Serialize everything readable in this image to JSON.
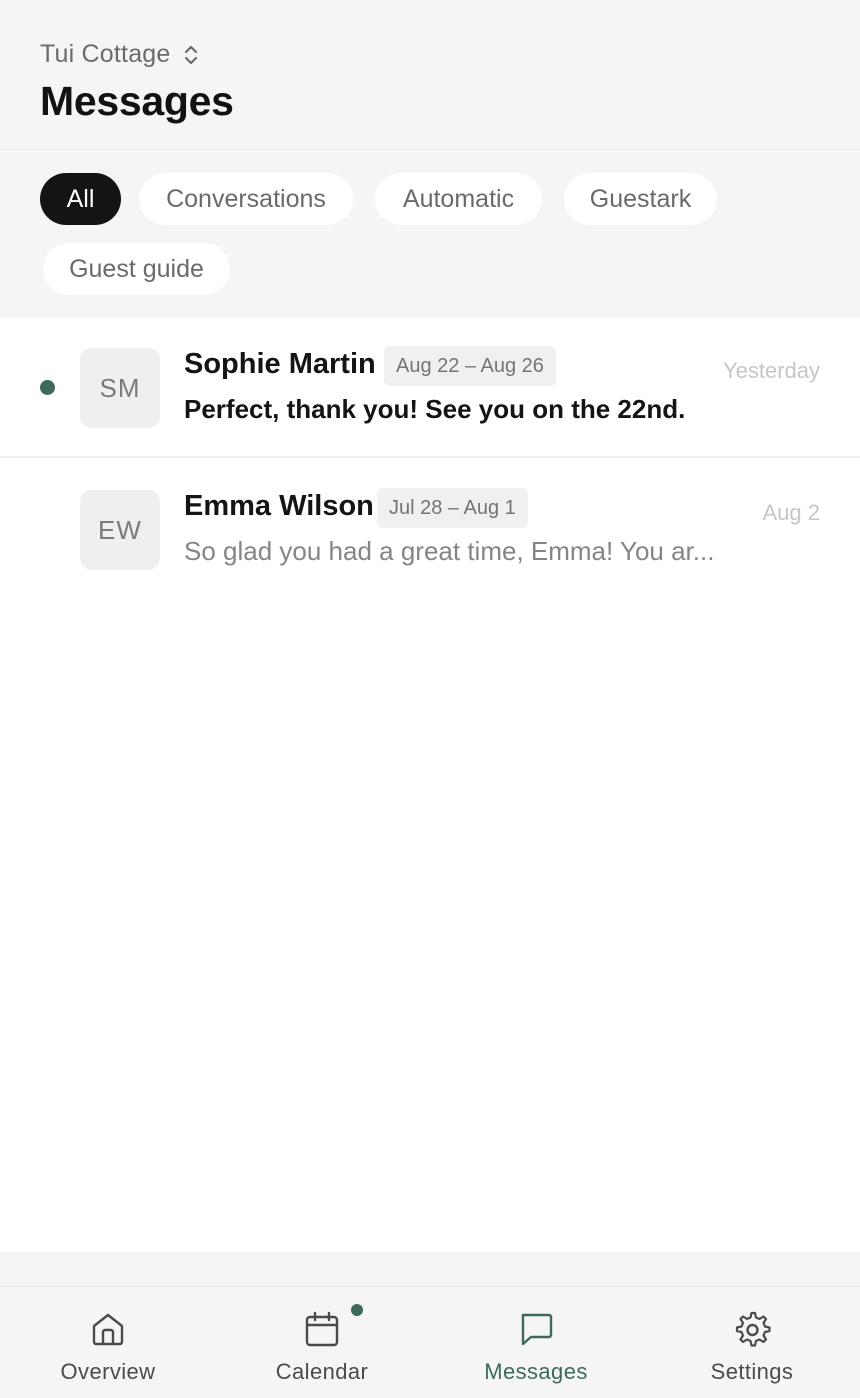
{
  "header": {
    "property_name": "Tui Cottage",
    "title": "Messages"
  },
  "filters": [
    {
      "label": "All",
      "active": true
    },
    {
      "label": "Conversations",
      "active": false
    },
    {
      "label": "Automatic",
      "active": false
    },
    {
      "label": "Guestark",
      "active": false
    },
    {
      "label": "Guest guide",
      "active": false
    }
  ],
  "conversations": [
    {
      "initials": "SM",
      "name": "Sophie Martin",
      "dates": "Aug 22 – Aug 26",
      "preview": "Perfect, thank you! See you on the 22nd.",
      "timestamp": "Yesterday",
      "unread": true
    },
    {
      "initials": "EW",
      "name": "Emma Wilson",
      "dates": "Jul 28 – Aug 1",
      "preview": "So glad you had a great time, Emma! You ar...",
      "timestamp": "Aug 2",
      "unread": false
    }
  ],
  "nav": {
    "items": [
      {
        "label": "Overview",
        "icon": "home-icon"
      },
      {
        "label": "Calendar",
        "icon": "calendar-icon",
        "badge": true
      },
      {
        "label": "Messages",
        "icon": "message-icon",
        "active": true
      },
      {
        "label": "Settings",
        "icon": "gear-icon"
      }
    ]
  },
  "colors": {
    "accent": "#3e6a5d",
    "chip_active_bg": "#141414",
    "background": "#f5f5f4"
  }
}
